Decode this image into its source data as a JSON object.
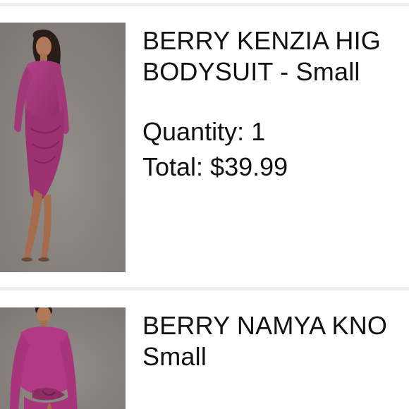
{
  "colors": {
    "divider": "#eeeeee",
    "photo_background": "#8a8481",
    "dress": "#a53a78",
    "text": "#111111"
  },
  "items": [
    {
      "name_line1": "BERRY KENZIA HIG",
      "name_line2": "BODYSUIT - Small",
      "quantity": "Quantity: 1",
      "total": "Total: $39.99",
      "thumbnail": "product-photo-model-in-berry-dress"
    },
    {
      "name_line1": "BERRY NAMYA KNO",
      "name_line2": "Small",
      "thumbnail": "product-photo-model-in-berry-dress"
    }
  ]
}
